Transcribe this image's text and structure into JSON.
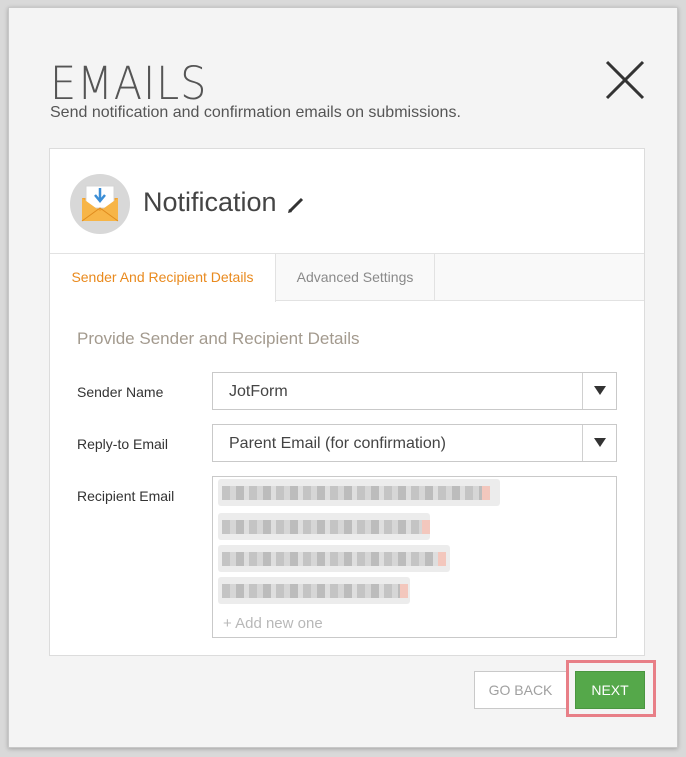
{
  "dialog": {
    "title": "EMAILS",
    "subtitle": "Send notification and confirmation emails on submissions."
  },
  "card": {
    "title": "Notification",
    "tabs": [
      {
        "label": "Sender And Recipient Details",
        "active": true
      },
      {
        "label": "Advanced Settings",
        "active": false
      }
    ],
    "section_title": "Provide Sender and Recipient Details",
    "sender_name": {
      "label": "Sender Name",
      "value": "JotForm"
    },
    "reply_to": {
      "label": "Reply-to Email",
      "value": "Parent Email (for confirmation)"
    },
    "recipient": {
      "label": "Recipient Email",
      "add_placeholder": "+ Add new one"
    }
  },
  "buttons": {
    "back": "GO BACK",
    "next": "NEXT"
  },
  "colors": {
    "accent": "#e98a1e",
    "next_button": "#55a84a",
    "highlight": "#e87f87"
  },
  "icons": [
    "close-icon",
    "envelope-icon",
    "pencil-icon",
    "dropdown-arrow-icon"
  ]
}
